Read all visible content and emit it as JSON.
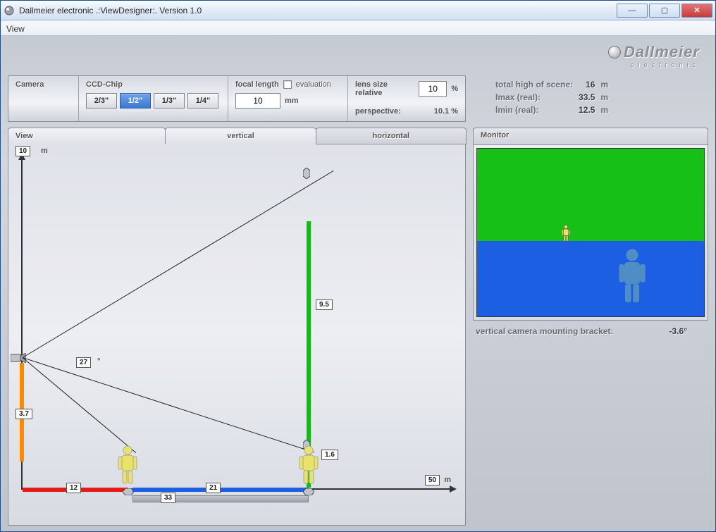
{
  "window": {
    "title": "Dallmeier electronic .:ViewDesigner:. Version 1.0"
  },
  "menu": {
    "view": "View"
  },
  "brand": {
    "name": "Dallmeier",
    "sub": "electronic"
  },
  "settings": {
    "camera_label": "Camera",
    "ccd_label": "CCD-Chip",
    "chips": [
      "2/3\"",
      "1/2\"",
      "1/3\"",
      "1/4\""
    ],
    "focal_label": "focal length",
    "eval_label": "evaluation",
    "focal_value": "10",
    "focal_unit": "mm",
    "lens_label": "lens size relative",
    "lens_value": "10",
    "lens_unit": "%",
    "persp_label": "perspective:",
    "persp_value": "10.1",
    "persp_unit": "%"
  },
  "stats": {
    "total_label": "total high of scene:",
    "total_value": "16",
    "total_unit": "m",
    "lmax_label": "lmax (real):",
    "lmax_value": "33.5",
    "lmax_unit": "m",
    "lmin_label": "lmin (real):",
    "lmin_value": "12.5",
    "lmin_unit": "m"
  },
  "tabs": {
    "view": "View",
    "vertical": "vertical",
    "horizontal": "horizontal"
  },
  "diagram": {
    "y_value": "10",
    "y_unit": "m",
    "x_value": "50",
    "x_unit": "m",
    "angle": "27",
    "angle_unit": "°",
    "cam_height": "3.7",
    "green_height": "9.5",
    "red_dist": "12",
    "blue_dist": "21",
    "grey_dist": "33",
    "person_h": "1.6"
  },
  "monitor": {
    "header": "Monitor",
    "bracket_label": "vertical camera mounting bracket:",
    "bracket_value": "-3.6°"
  },
  "chart_data": {
    "type": "diagram",
    "title": "Vertical view geometry",
    "units": "m",
    "camera": {
      "height_m": 3.7,
      "fov_deg": 27,
      "mount_angle_deg": -3.6
    },
    "ground": {
      "near_m": 12,
      "far_m": 33,
      "blue_segment_m": 21
    },
    "scene": {
      "top_height_m": 9.5,
      "total_scene_height_m": 16
    },
    "person": {
      "height_m": 1.6
    },
    "axis": {
      "y_max_m": 10,
      "x_max_m": 50
    },
    "rays": {
      "lmax_m": 33.5,
      "lmin_m": 12.5
    },
    "optics": {
      "focal_length_mm": 10,
      "ccd": "1/2\"",
      "lens_size_relative_pct": 10,
      "perspective_pct": 10.1
    }
  }
}
